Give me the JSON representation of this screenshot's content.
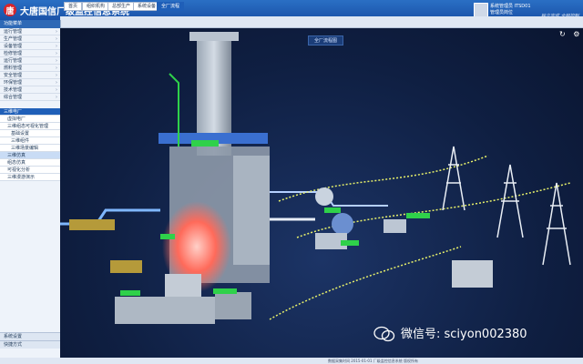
{
  "app": {
    "title": "大唐国信厂级监控信息系统",
    "logo": "唐"
  },
  "user": {
    "name": "系统管理员 ITSD01",
    "role": "管理员岗位",
    "slogan": "独立完成 全程控制"
  },
  "tabs": [
    {
      "label": "首页",
      "active": false
    },
    {
      "label": "组织机构",
      "active": false
    },
    {
      "label": "总部生产",
      "active": false
    },
    {
      "label": "系统设备",
      "active": false
    },
    {
      "label": "全厂流程",
      "active": true
    }
  ],
  "sidebar": {
    "header": "功能菜单",
    "items": [
      {
        "label": "运行管理",
        "level": 0,
        "state": "normal"
      },
      {
        "label": "生产管理",
        "level": 0,
        "state": "normal"
      },
      {
        "label": "设备管理",
        "level": 0,
        "state": "normal"
      },
      {
        "label": "检修管理",
        "level": 0,
        "state": "normal"
      },
      {
        "label": "运行管理",
        "level": 0,
        "state": "normal"
      },
      {
        "label": "燃料管理",
        "level": 0,
        "state": "normal"
      },
      {
        "label": "安全管理",
        "level": 0,
        "state": "normal"
      },
      {
        "label": "环保管理",
        "level": 0,
        "state": "normal"
      },
      {
        "label": "技术管理",
        "level": 0,
        "state": "normal"
      },
      {
        "label": "综合管理",
        "level": 0,
        "state": "normal"
      },
      {
        "label": "三维电厂",
        "level": 0,
        "state": "selected"
      },
      {
        "label": "虚拟电厂",
        "level": 1,
        "state": "normal"
      },
      {
        "label": "三维组态可视化管理",
        "level": 1,
        "state": "normal"
      },
      {
        "label": "基础设置",
        "level": 2,
        "state": "normal"
      },
      {
        "label": "三维组件",
        "level": 2,
        "state": "normal"
      },
      {
        "label": "三维场景编辑",
        "level": 2,
        "state": "normal"
      },
      {
        "label": "三维仿真",
        "level": 1,
        "state": "highlight"
      },
      {
        "label": "组态仿真",
        "level": 1,
        "state": "normal"
      },
      {
        "label": "可视化分析",
        "level": 1,
        "state": "normal"
      },
      {
        "label": "三维漫游演示",
        "level": 1,
        "state": "normal"
      }
    ],
    "footer": [
      "系统设置",
      "快捷方式"
    ]
  },
  "scene": {
    "title": "全厂流程图",
    "tools": {
      "refresh": "refresh-icon",
      "settings": "gear-icon"
    },
    "colors": {
      "pipe": "#7fb7ff",
      "tag": "#2fd14a",
      "flame": "#ff6a5a",
      "cable": "#e7f06a"
    }
  },
  "status_text": "数据采集时间 2015-01-01 厂级监控信息系统 版权所有",
  "watermark": "微信号: sciyon002380"
}
